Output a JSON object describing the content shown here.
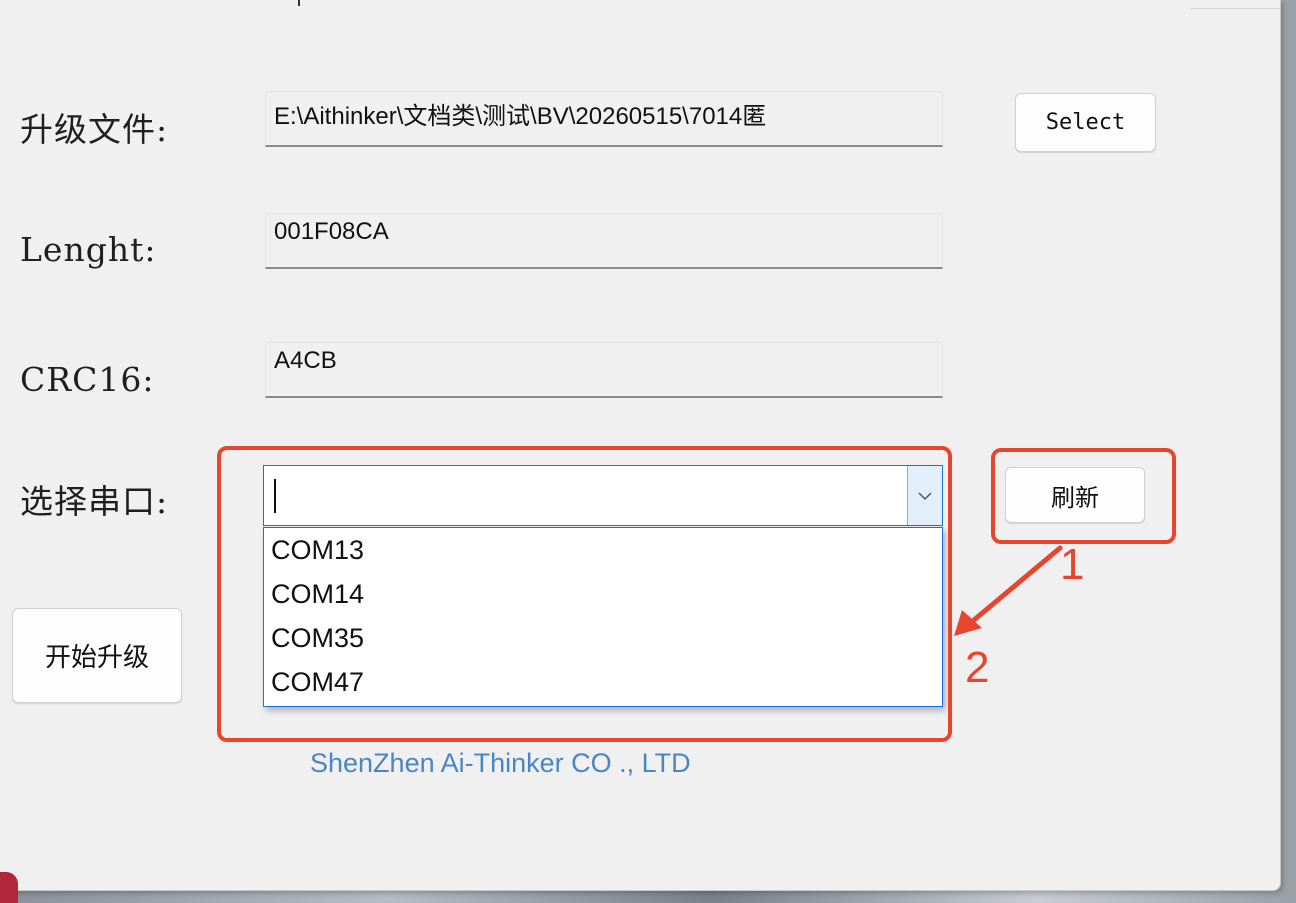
{
  "form": {
    "file_label": "升级文件:",
    "file_value": "E:\\Aithinker\\文档类\\测试\\BV\\20260515\\7014匿",
    "select_button": "Select",
    "length_label": "Lenght:",
    "length_value": "001F08CA",
    "crc_label": "CRC16:",
    "crc_value": "A4CB",
    "port_label": "选择串口:",
    "port_value": "",
    "refresh_button": "刷新",
    "start_button": "开始升级",
    "port_options": [
      "COM13",
      "COM14",
      "COM35",
      "COM47"
    ]
  },
  "footer": {
    "company": "ShenZhen Ai-Thinker CO ., LTD"
  },
  "annotations": {
    "arrow_from": "1",
    "arrow_to": "2",
    "color": "#e8452f"
  },
  "colors": {
    "accent": "#1e6fd9",
    "footer_text": "#4a86c4"
  }
}
